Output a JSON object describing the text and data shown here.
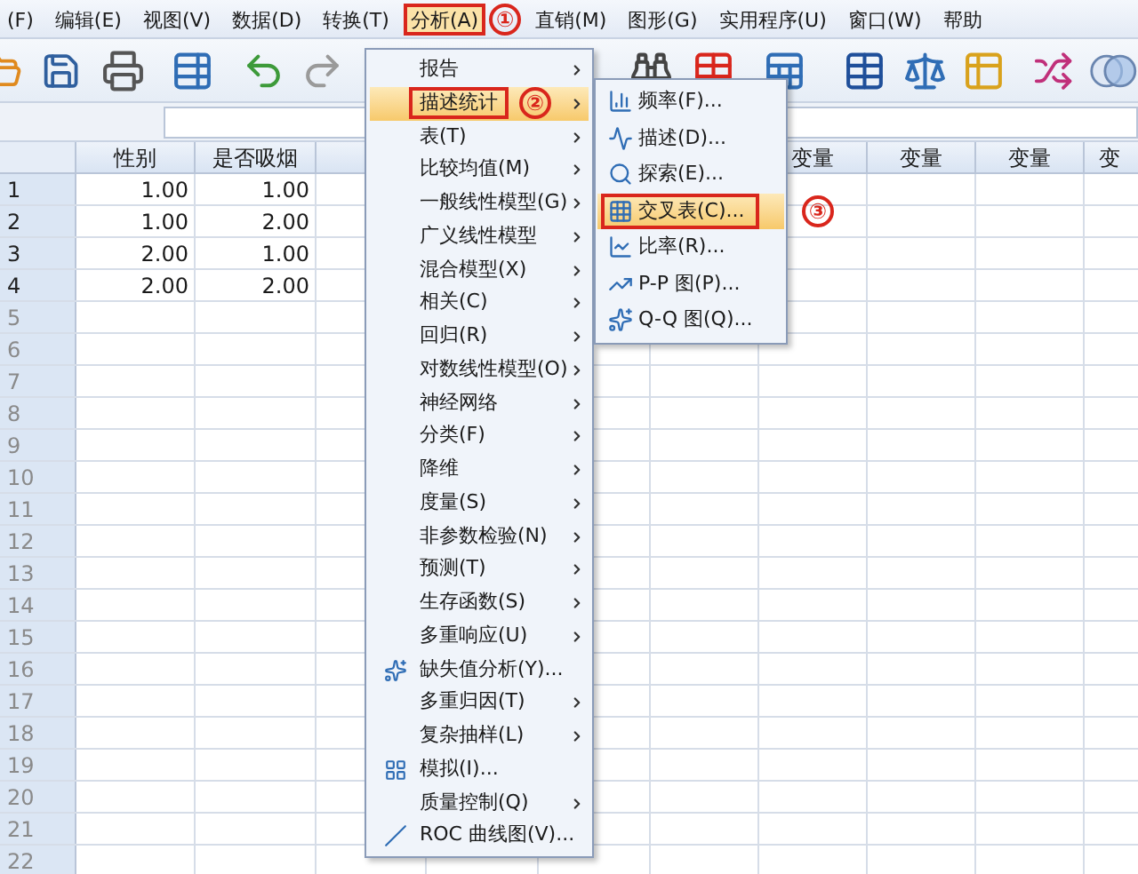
{
  "menubar": [
    {
      "label": "(F)",
      "selected": false
    },
    {
      "label": "编辑(E)",
      "selected": false
    },
    {
      "label": "视图(V)",
      "selected": false
    },
    {
      "label": "数据(D)",
      "selected": false
    },
    {
      "label": "转换(T)",
      "selected": false
    },
    {
      "label": "分析(A)",
      "selected": true,
      "callout": "①"
    },
    {
      "label": "直销(M)",
      "selected": false
    },
    {
      "label": "图形(G)",
      "selected": false
    },
    {
      "label": "实用程序(U)",
      "selected": false
    },
    {
      "label": "窗口(W)",
      "selected": false
    },
    {
      "label": "帮助",
      "selected": false
    }
  ],
  "grid": {
    "columns": [
      "性别",
      "是否吸烟"
    ],
    "variable_columns": [
      "变量",
      "变量",
      "变量",
      "变"
    ],
    "rows": [
      {
        "number": "1",
        "cells": [
          "1.00",
          "1.00"
        ]
      },
      {
        "number": "2",
        "cells": [
          "1.00",
          "2.00"
        ]
      },
      {
        "number": "3",
        "cells": [
          "2.00",
          "1.00"
        ]
      },
      {
        "number": "4",
        "cells": [
          "2.00",
          "2.00"
        ]
      },
      {
        "number": "5"
      },
      {
        "number": "6"
      },
      {
        "number": "7"
      },
      {
        "number": "8"
      },
      {
        "number": "9"
      },
      {
        "number": "10"
      },
      {
        "number": "11"
      },
      {
        "number": "12"
      },
      {
        "number": "13"
      },
      {
        "number": "14"
      },
      {
        "number": "15"
      },
      {
        "number": "16"
      },
      {
        "number": "17"
      },
      {
        "number": "18"
      },
      {
        "number": "19"
      },
      {
        "number": "20"
      },
      {
        "number": "21"
      },
      {
        "number": "22"
      }
    ]
  },
  "analyze_menu": [
    {
      "label": "报告",
      "kind": "submenu",
      "selected": false
    },
    {
      "label": "描述统计",
      "kind": "submenu",
      "selected": true,
      "callout": "②"
    },
    {
      "label": "表(T)",
      "kind": "submenu",
      "selected": false
    },
    {
      "label": "比较均值(M)",
      "kind": "submenu",
      "selected": false
    },
    {
      "label": "一般线性模型(G)",
      "kind": "submenu",
      "selected": false
    },
    {
      "label": "广义线性模型",
      "kind": "submenu",
      "selected": false
    },
    {
      "label": "混合模型(X)",
      "kind": "submenu",
      "selected": false
    },
    {
      "label": "相关(C)",
      "kind": "submenu",
      "selected": false
    },
    {
      "label": "回归(R)",
      "kind": "submenu",
      "selected": false
    },
    {
      "label": "对数线性模型(O)",
      "kind": "submenu",
      "selected": false
    },
    {
      "label": "神经网络",
      "kind": "submenu",
      "selected": false
    },
    {
      "label": "分类(F)",
      "kind": "submenu",
      "selected": false
    },
    {
      "label": "降维",
      "kind": "submenu",
      "selected": false
    },
    {
      "label": "度量(S)",
      "kind": "submenu",
      "selected": false
    },
    {
      "label": "非参数检验(N)",
      "kind": "submenu",
      "selected": false
    },
    {
      "label": "预测(T)",
      "kind": "submenu",
      "selected": false
    },
    {
      "label": "生存函数(S)",
      "kind": "submenu",
      "selected": false
    },
    {
      "label": "多重响应(U)",
      "kind": "submenu",
      "selected": false
    },
    {
      "label": "缺失值分析(Y)...",
      "kind": "command",
      "selected": false
    },
    {
      "label": "多重归因(T)",
      "kind": "submenu",
      "selected": false
    },
    {
      "label": "复杂抽样(L)",
      "kind": "submenu",
      "selected": false
    },
    {
      "label": "模拟(I)...",
      "kind": "command",
      "selected": false
    },
    {
      "label": "质量控制(Q)",
      "kind": "submenu",
      "selected": false
    },
    {
      "label": "ROC 曲线图(V)...",
      "kind": "command",
      "selected": false
    }
  ],
  "descriptive_submenu": [
    {
      "label": "频率(F)...",
      "selected": false
    },
    {
      "label": "描述(D)...",
      "selected": false
    },
    {
      "label": "探索(E)...",
      "selected": false
    },
    {
      "label": "交叉表(C)...",
      "selected": true,
      "callout": "③"
    },
    {
      "label": "比率(R)...",
      "selected": false
    },
    {
      "label": "P-P 图(P)...",
      "selected": false
    },
    {
      "label": "Q-Q 图(Q)...",
      "selected": false
    }
  ]
}
